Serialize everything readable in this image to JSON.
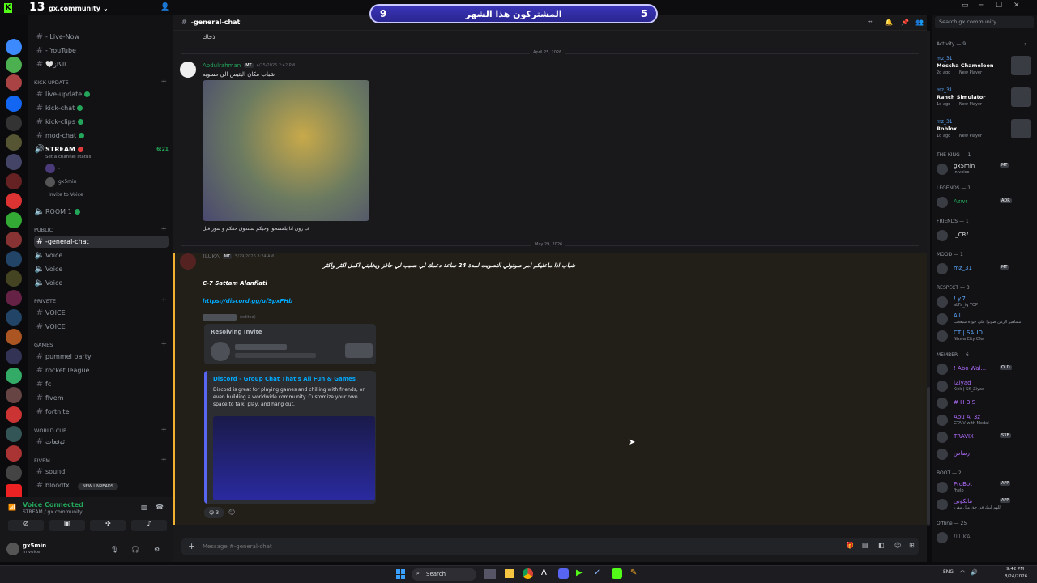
{
  "banner": {
    "left_num": "9",
    "title": "المشتركون هذا الشهر",
    "right_num": "5"
  },
  "window": {
    "left_badge": "13",
    "server_name": "gx.community"
  },
  "channels": {
    "top": [
      "- Live-Now",
      "- YouTube",
      "الكاز"
    ],
    "kick_cat": "kick update",
    "kick": [
      "live-update",
      "kick-chat",
      "kick-clips",
      "mod-chat"
    ],
    "stream": {
      "name": "STREAM",
      "status": "Set a channel status",
      "time": "6:21",
      "user": "gx5min",
      "invite": "Invite to Voice",
      "dot_user": "."
    },
    "room": "ROOM 1",
    "public_cat": "PUBLIC",
    "public": [
      "-general-chat",
      "Voice",
      "Voice",
      "Voice"
    ],
    "private_cat": "PRIVETE",
    "private": [
      "VOICE",
      "VOICE"
    ],
    "games_cat": "GAMES",
    "games": [
      "pummel party",
      "rocket league",
      "fc",
      "fivem",
      "fortnite"
    ],
    "wc_cat": "WORLD CUP",
    "wc": [
      "توقعات"
    ],
    "fivem_cat": "FIVEM",
    "fivem": [
      "sound",
      "bloodfx"
    ],
    "new_unreads": "NEW UNREADS"
  },
  "voice": {
    "connected": "Voice Connected",
    "where": "STREAM / gx.community"
  },
  "user": {
    "name": "gx5min",
    "status": "In voice"
  },
  "header": {
    "channel": "-general-chat",
    "search": "Search gx.community"
  },
  "messages": {
    "top_text": "ذحاك",
    "date1": "April 25, 2026",
    "m1": {
      "author": "Abdulrahman",
      "tag": "MT",
      "time": "4/25/2026 2:42 PM",
      "text": "شباب مكان اليتيس الي مسويه",
      "caption": "ف زون انا بلمسحوا وحيكم سنتدوق حقكم و سور فيل"
    },
    "date2": "May 29, 2026",
    "m2": {
      "author": "!LUKA",
      "tag": "MT",
      "time": "5/29/2026 3:24 AM",
      "text": "شباب اذا ماعليكم امر صوتولي التصويت لمدة 24 ساعة دعمك لي بسبب لي حافز ويخليني اكمل اكثر واكثر",
      "line2": "C-7 Sattam Alanflati",
      "link": "https://discord.gg/uf9pxFHb",
      "edited": "(edited)",
      "invite_title": "Resolving Invite",
      "embed_title": "Discord - Group Chat That's All Fun & Games",
      "embed_desc": "Discord is great for playing games and chilling with friends, or even building a worldwide community. Customize your own space to talk, play, and hang out.",
      "reaction_count": "3"
    }
  },
  "composer": {
    "placeholder": "Message #-general-chat"
  },
  "members": {
    "activity_head": "Activity — 9",
    "activity": [
      {
        "user": "mz_31",
        "game": "Meccha Chameleon",
        "sub": "2d ago",
        "badge": "New Player"
      },
      {
        "user": "mz_31",
        "game": "Ranch Simulator",
        "sub": "1d ago",
        "badge": "New Player"
      },
      {
        "user": "mz_31",
        "game": "Roblox",
        "sub": "1d ago",
        "badge": "New Player"
      }
    ],
    "groups": [
      {
        "head": "THE KING — 1",
        "items": [
          {
            "name": "gx5min",
            "sub": "In voice",
            "tag": "MT",
            "color": "#dbdee1"
          }
        ]
      },
      {
        "head": "LEGENDS — 1",
        "items": [
          {
            "name": "Azwr",
            "sub": "",
            "tag": "ADR",
            "color": "#23a55a"
          }
        ]
      },
      {
        "head": "FRIENDS — 1",
        "items": [
          {
            "name": "._CR³",
            "sub": "",
            "tag": "",
            "color": "#dbdee1"
          }
        ]
      },
      {
        "head": "MOOD — 1",
        "items": [
          {
            "name": "mz_31",
            "sub": "",
            "tag": "MT",
            "color": "#5da9ff"
          }
        ]
      },
      {
        "head": "RESPECT — 3",
        "items": [
          {
            "name": "! y.7",
            "sub": "aLFa_iq TOP",
            "tag": "",
            "color": "#5da9ff"
          },
          {
            "name": "All.",
            "sub": "مشاهير الزمن صوتوا على جودة سيعجب",
            "tag": "",
            "color": "#5da9ff"
          },
          {
            "name": "CT | SAUD",
            "sub": "Nizwa City Cfw",
            "tag": "",
            "color": "#5da9ff"
          }
        ]
      },
      {
        "head": "MEMBER — 6",
        "items": [
          {
            "name": "! Abo Wal...",
            "sub": "",
            "tag": "OLD",
            "color": "#b06cff"
          },
          {
            "name": "iZiyad",
            "sub": "Kick | SK_Ziyad",
            "tag": "",
            "color": "#b06cff"
          },
          {
            "name": "# H B S",
            "sub": "",
            "tag": "",
            "color": "#b06cff"
          },
          {
            "name": "Abu Al 3z",
            "sub": "GTA V with Medal",
            "tag": "",
            "color": "#b06cff"
          },
          {
            "name": "TRAVIX",
            "sub": "",
            "tag": "SXB",
            "color": "#b06cff"
          },
          {
            "name": "رصاص",
            "sub": "",
            "tag": "",
            "color": "#b06cff"
          }
        ]
      },
      {
        "head": "BOOT — 2",
        "items": [
          {
            "name": "ProBot",
            "sub": "/help",
            "tag": "APP",
            "color": "#b06cff"
          },
          {
            "name": "مانكوتي",
            "sub": "اللهم لبيك في حق ملل مقرر",
            "tag": "APP",
            "color": "#b06cff"
          }
        ]
      },
      {
        "head": "Offline — 25",
        "items": [
          {
            "name": "!LUKA",
            "sub": "",
            "tag": "",
            "color": "#6d6f78"
          }
        ]
      }
    ]
  },
  "taskbar": {
    "search": "Search",
    "lang": "ENG",
    "time": "9:42 PM",
    "date": "8/24/2026"
  },
  "colors": {
    "accent": "#5865f2",
    "online": "#23a55a",
    "highlight": "#f0b132",
    "banner": "#3a35b8"
  }
}
